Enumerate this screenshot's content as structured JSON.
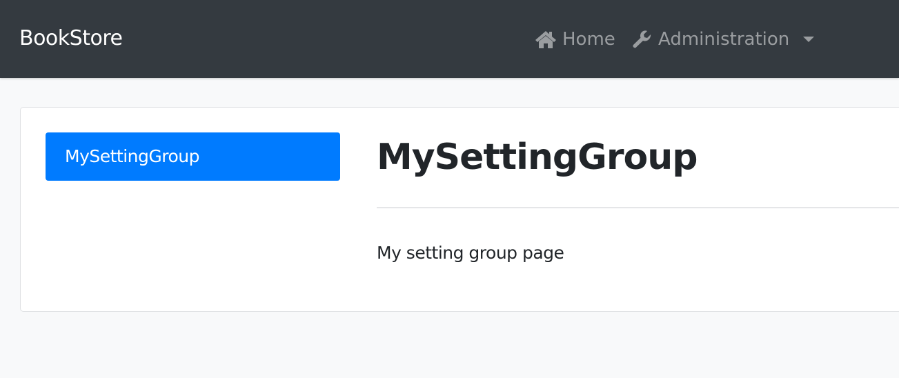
{
  "navbar": {
    "brand": "BookStore",
    "items": [
      {
        "label": "Home",
        "icon": "home-icon"
      },
      {
        "label": "Administration",
        "icon": "wrench-icon",
        "dropdown": true
      }
    ]
  },
  "sidebar": {
    "items": [
      {
        "label": "MySettingGroup",
        "active": true
      }
    ]
  },
  "main": {
    "title": "MySettingGroup",
    "text": "My setting group page"
  },
  "colors": {
    "navbar": "#343a40",
    "active": "#007bff"
  }
}
